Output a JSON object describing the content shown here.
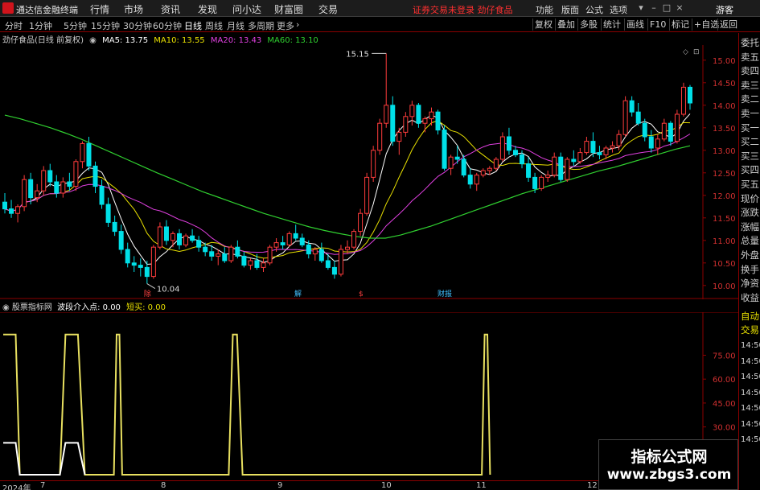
{
  "app": {
    "title": "通达信金融终端",
    "menus": [
      "行情",
      "市场",
      "资讯",
      "发现",
      "问小达",
      "财富圈",
      "交易"
    ],
    "notice": "证券交易未登录   劲仔食品",
    "right_menus": [
      "功能",
      "版面",
      "公式",
      "选项"
    ],
    "user": "游客"
  },
  "toolbar": {
    "periods": [
      "分时",
      "1分钟",
      "5分钟",
      "15分钟",
      "30分钟",
      "60分钟",
      "日线",
      "周线",
      "月线",
      "多周期",
      "更多"
    ],
    "active_period": "日线",
    "buttons": [
      "复权",
      "叠加",
      "多股",
      "统计",
      "画线",
      "F10",
      "标记",
      "+自选",
      "返回"
    ]
  },
  "info_line": {
    "stock": "劲仔食品(日线 前复权)",
    "ma5": "MA5: 13.75",
    "ma10": "MA10: 13.55",
    "ma20": "MA20: 13.43",
    "ma60": "MA60: 13.10",
    "colors": {
      "ma5": "#ffffff",
      "ma10": "#e8e000",
      "ma20": "#e040e0",
      "ma60": "#30d030"
    }
  },
  "side_panel": {
    "items": [
      "委托",
      "卖五",
      "卖四",
      "卖三",
      "卖二",
      "卖一",
      "买一",
      "买二",
      "买三",
      "买四",
      "买五",
      "现价",
      "涨跌",
      "涨幅",
      "总量",
      "外盘",
      "换手",
      "净资",
      "收益",
      "自动",
      "交易",
      "14:50",
      "14:50",
      "14:50",
      "14:50",
      "14:50",
      "14:50",
      "14:50"
    ]
  },
  "indicator": {
    "name": "股票指标网",
    "signal1": "波段介入点: 0.00",
    "signal2": "短买: 0.00"
  },
  "annotations": {
    "high_label": "15.15",
    "low_label": "10.04",
    "event_marks": [
      "除",
      "解",
      "$",
      "财报"
    ]
  },
  "dates": [
    "2024年",
    "7",
    "8",
    "9",
    "10",
    "11",
    "12"
  ],
  "watermark": {
    "title": "指标公式网",
    "url": "www.zbgs3.com"
  },
  "colors": {
    "up": "#ff3c3c",
    "down": "#00e0e8",
    "frame": "#8b0000",
    "signal_line": "#e8e060"
  },
  "chart_data": [
    {
      "type": "candlestick",
      "title": "",
      "ylim": [
        9.8,
        15.3
      ],
      "yticks": [
        10.0,
        10.5,
        11.0,
        11.5,
        12.0,
        12.5,
        13.0,
        13.5,
        14.0,
        14.5,
        15.0
      ],
      "ohlc": [
        [
          11.85,
          12.05,
          11.6,
          11.7
        ],
        [
          11.7,
          11.9,
          11.5,
          11.6
        ],
        [
          11.6,
          11.8,
          11.4,
          11.75
        ],
        [
          11.75,
          12.45,
          11.65,
          12.35
        ],
        [
          12.35,
          12.5,
          11.8,
          11.95
        ],
        [
          11.95,
          12.25,
          11.85,
          12.1
        ],
        [
          12.1,
          12.65,
          12.0,
          12.55
        ],
        [
          12.55,
          12.7,
          12.2,
          12.3
        ],
        [
          12.3,
          12.45,
          11.95,
          12.05
        ],
        [
          12.05,
          12.4,
          11.95,
          12.3
        ],
        [
          12.3,
          12.5,
          12.1,
          12.2
        ],
        [
          12.2,
          12.8,
          12.1,
          12.75
        ],
        [
          12.75,
          13.2,
          12.6,
          13.15
        ],
        [
          13.15,
          13.3,
          12.55,
          12.65
        ],
        [
          12.65,
          12.75,
          12.05,
          12.2
        ],
        [
          12.2,
          12.35,
          11.7,
          11.8
        ],
        [
          11.8,
          11.95,
          11.3,
          11.4
        ],
        [
          11.4,
          11.55,
          11.1,
          11.2
        ],
        [
          11.2,
          11.35,
          10.7,
          10.8
        ],
        [
          10.8,
          10.95,
          10.4,
          10.5
        ],
        [
          10.5,
          10.65,
          10.3,
          10.45
        ],
        [
          10.45,
          10.6,
          10.2,
          10.4
        ],
        [
          10.4,
          10.55,
          10.04,
          10.2
        ],
        [
          10.2,
          10.9,
          10.15,
          10.85
        ],
        [
          10.85,
          11.4,
          10.8,
          11.3
        ],
        [
          11.3,
          11.45,
          10.9,
          11.0
        ],
        [
          11.0,
          11.2,
          10.85,
          11.15
        ],
        [
          11.15,
          11.25,
          10.8,
          10.9
        ],
        [
          10.9,
          11.15,
          10.85,
          11.1
        ],
        [
          11.1,
          11.25,
          10.95,
          11.0
        ],
        [
          11.0,
          11.1,
          10.75,
          10.85
        ],
        [
          10.85,
          10.95,
          10.65,
          10.75
        ],
        [
          10.75,
          10.9,
          10.55,
          10.65
        ],
        [
          10.65,
          10.8,
          10.45,
          10.7
        ],
        [
          10.7,
          10.85,
          10.5,
          10.55
        ],
        [
          10.55,
          10.9,
          10.5,
          10.85
        ],
        [
          10.85,
          11.0,
          10.6,
          10.65
        ],
        [
          10.65,
          10.75,
          10.4,
          10.45
        ],
        [
          10.45,
          10.6,
          10.35,
          10.55
        ],
        [
          10.55,
          10.7,
          10.35,
          10.4
        ],
        [
          10.4,
          10.6,
          10.3,
          10.5
        ],
        [
          10.5,
          10.9,
          10.45,
          10.85
        ],
        [
          10.85,
          11.05,
          10.75,
          10.95
        ],
        [
          10.95,
          11.1,
          10.8,
          10.9
        ],
        [
          10.9,
          11.2,
          10.85,
          11.15
        ],
        [
          11.15,
          11.35,
          11.0,
          11.05
        ],
        [
          11.05,
          11.15,
          10.85,
          10.9
        ],
        [
          10.9,
          11.0,
          10.6,
          10.7
        ],
        [
          10.7,
          10.85,
          10.55,
          10.8
        ],
        [
          10.8,
          10.95,
          10.5,
          10.55
        ],
        [
          10.55,
          10.7,
          10.35,
          10.4
        ],
        [
          10.4,
          10.55,
          10.15,
          10.25
        ],
        [
          10.25,
          10.9,
          10.2,
          10.8
        ],
        [
          10.8,
          11.0,
          10.7,
          10.85
        ],
        [
          10.85,
          11.25,
          10.8,
          11.2
        ],
        [
          11.2,
          11.7,
          11.1,
          11.6
        ],
        [
          11.6,
          12.5,
          11.55,
          12.4
        ],
        [
          12.4,
          13.1,
          12.3,
          13.0
        ],
        [
          13.0,
          13.7,
          12.9,
          13.6
        ],
        [
          13.6,
          15.15,
          13.5,
          14.0
        ],
        [
          14.0,
          14.2,
          13.1,
          13.2
        ],
        [
          13.2,
          13.5,
          12.9,
          13.4
        ],
        [
          13.4,
          13.85,
          13.3,
          13.75
        ],
        [
          13.75,
          14.1,
          13.55,
          14.0
        ],
        [
          14.0,
          14.05,
          13.5,
          13.6
        ],
        [
          13.6,
          13.75,
          13.4,
          13.7
        ],
        [
          13.7,
          13.95,
          13.55,
          13.85
        ],
        [
          13.85,
          13.9,
          13.35,
          13.45
        ],
        [
          13.45,
          13.55,
          12.55,
          12.6
        ],
        [
          12.6,
          12.9,
          12.45,
          12.85
        ],
        [
          12.85,
          13.1,
          12.7,
          12.8
        ],
        [
          12.8,
          12.9,
          12.4,
          12.45
        ],
        [
          12.45,
          12.6,
          12.15,
          12.25
        ],
        [
          12.25,
          12.5,
          12.1,
          12.45
        ],
        [
          12.45,
          12.6,
          12.4,
          12.55
        ],
        [
          12.55,
          12.65,
          12.45,
          12.6
        ],
        [
          12.6,
          12.85,
          12.55,
          12.8
        ],
        [
          12.8,
          13.4,
          12.75,
          13.3
        ],
        [
          13.3,
          13.5,
          12.9,
          13.0
        ],
        [
          13.0,
          13.1,
          12.85,
          12.9
        ],
        [
          12.9,
          13.0,
          12.6,
          12.7
        ],
        [
          12.7,
          12.85,
          12.3,
          12.4
        ],
        [
          12.4,
          12.5,
          12.05,
          12.15
        ],
        [
          12.15,
          12.45,
          12.1,
          12.4
        ],
        [
          12.4,
          12.55,
          12.3,
          12.45
        ],
        [
          12.45,
          12.95,
          12.4,
          12.85
        ],
        [
          12.85,
          12.95,
          12.3,
          12.35
        ],
        [
          12.35,
          12.85,
          12.3,
          12.8
        ],
        [
          12.8,
          13.0,
          12.65,
          12.75
        ],
        [
          12.75,
          13.05,
          12.7,
          12.95
        ],
        [
          12.95,
          13.3,
          12.9,
          13.2
        ],
        [
          13.2,
          13.4,
          12.85,
          12.95
        ],
        [
          12.95,
          13.1,
          12.8,
          12.9
        ],
        [
          12.9,
          13.1,
          12.8,
          13.05
        ],
        [
          13.05,
          13.2,
          12.95,
          13.1
        ],
        [
          13.1,
          13.45,
          13.0,
          13.35
        ],
        [
          13.35,
          14.2,
          13.3,
          14.1
        ],
        [
          14.1,
          14.2,
          13.75,
          13.85
        ],
        [
          13.85,
          14.05,
          13.55,
          13.6
        ],
        [
          13.6,
          13.7,
          13.2,
          13.3
        ],
        [
          13.3,
          13.45,
          12.95,
          13.05
        ],
        [
          13.05,
          13.35,
          12.9,
          13.25
        ],
        [
          13.25,
          13.7,
          13.2,
          13.6
        ],
        [
          13.6,
          13.65,
          13.1,
          13.2
        ],
        [
          13.2,
          13.9,
          13.15,
          13.8
        ],
        [
          13.8,
          14.5,
          13.75,
          14.4
        ],
        [
          14.4,
          14.45,
          13.9,
          14.05
        ]
      ],
      "ma60_points": [
        13.78,
        13.7,
        13.6,
        13.5,
        13.38,
        13.25,
        13.1,
        12.95,
        12.8,
        12.65,
        12.5,
        12.36,
        12.22,
        12.08,
        11.96,
        11.84,
        11.72,
        11.6,
        11.5,
        11.4,
        11.3,
        11.22,
        11.15,
        11.09,
        11.05,
        11.05,
        11.12,
        11.22,
        11.32,
        11.44,
        11.56,
        11.68,
        11.8,
        11.92,
        12.04,
        12.14,
        12.24,
        12.34,
        12.44,
        12.54,
        12.62,
        12.72,
        12.82,
        12.92,
        13.02,
        13.1
      ]
    },
    {
      "type": "line",
      "title": "",
      "ylim": [
        0,
        100
      ],
      "yticks": [
        30.0,
        45.0,
        60.0,
        75.0
      ],
      "series": [
        {
          "name": "波段介入点",
          "x": [
            0,
            4,
            9,
            12,
            41,
            45,
            54,
            59,
            80,
            82,
            84,
            86,
            163,
            166,
            169,
            173,
            346,
            348,
            350,
            352
          ],
          "y": [
            88,
            88,
            88,
            0,
            0,
            88,
            88,
            0,
            0,
            88,
            88,
            0,
            0,
            88,
            88,
            0,
            0,
            88,
            88,
            0
          ]
        },
        {
          "name": "短买",
          "x": [
            0,
            5,
            9,
            12,
            41,
            45,
            54,
            59
          ],
          "y": [
            20,
            20,
            20,
            0,
            0,
            20,
            20,
            0
          ]
        }
      ]
    }
  ]
}
